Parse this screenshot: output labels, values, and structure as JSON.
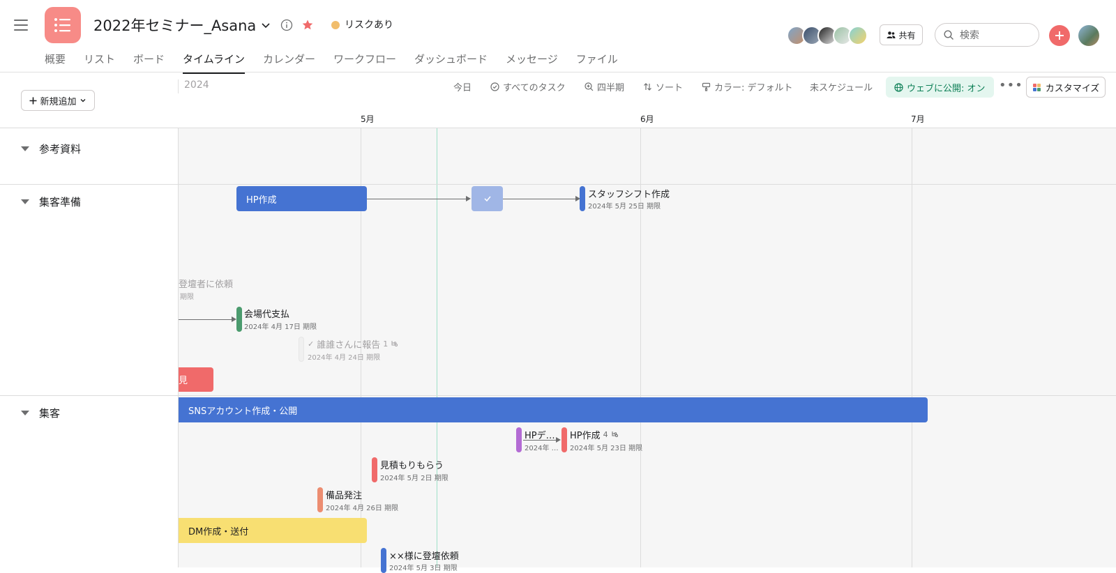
{
  "header": {
    "project_title": "2022年セミナー_Asana",
    "status": "リスクあり",
    "share_label": "共有",
    "search_placeholder": "検索",
    "tabs": [
      {
        "label": "概要",
        "active": false
      },
      {
        "label": "リスト",
        "active": false
      },
      {
        "label": "ボード",
        "active": false
      },
      {
        "label": "タイムライン",
        "active": true
      },
      {
        "label": "カレンダー",
        "active": false
      },
      {
        "label": "ワークフロー",
        "active": false
      },
      {
        "label": "ダッシュボード",
        "active": false
      },
      {
        "label": "メッセージ",
        "active": false
      },
      {
        "label": "ファイル",
        "active": false
      }
    ]
  },
  "toolbar": {
    "add_label": "新規追加",
    "year": "2024",
    "today": "今日",
    "all_tasks": "すべてのタスク",
    "quarter": "四半期",
    "sort": "ソート",
    "color": "カラー: デフォルト",
    "unscheduled": "未スケジュール",
    "publish": "ウェブに公開: オン",
    "customize": "カスタマイズ"
  },
  "timeline": {
    "months": [
      "5月",
      "6月",
      "7月"
    ],
    "sections": [
      {
        "name": "参考資料"
      },
      {
        "name": "集客準備"
      },
      {
        "name": "集客"
      }
    ],
    "tasks": {
      "hp_bar": "HP作成",
      "staff_shift": {
        "name": "スタッフシフト作成",
        "date": "2024年 5月 25日 期限"
      },
      "stage_request": {
        "name": "登壇者に依頼",
        "date": "期限"
      },
      "venue_payment": {
        "name": "会場代支払",
        "date": "2024年 4月 17日 期限"
      },
      "report": {
        "name": "誰誰さんに報告",
        "subtasks": "1",
        "date": "2024年 4月 24日 期限"
      },
      "red_bar": "見",
      "sns": "SNSアカウント作成・公開",
      "hp_design": {
        "name": "HPデ…",
        "date": "2024年 …"
      },
      "hp_create": {
        "name": "HP作成",
        "subtasks": "4",
        "date": "2024年 5月 23日 期限"
      },
      "estimate": {
        "name": "見積もりもらう",
        "date": "2024年 5月 2日 期限"
      },
      "supplies": {
        "name": "備品発注",
        "date": "2024年 4月 26日 期限"
      },
      "dm": "DM作成・送付",
      "xx_request": {
        "name": "××様に登壇依頼",
        "date": "2024年 5月 3日 期限"
      }
    }
  },
  "colors": {
    "blue": "#4573d2",
    "light_blue": "#a0b6e6",
    "green": "#4b9b6e",
    "red": "#f06a6a",
    "purple": "#b36bd4",
    "orange": "#ec8d71",
    "yellow": "#f8df72",
    "brand": "#f78b87"
  }
}
